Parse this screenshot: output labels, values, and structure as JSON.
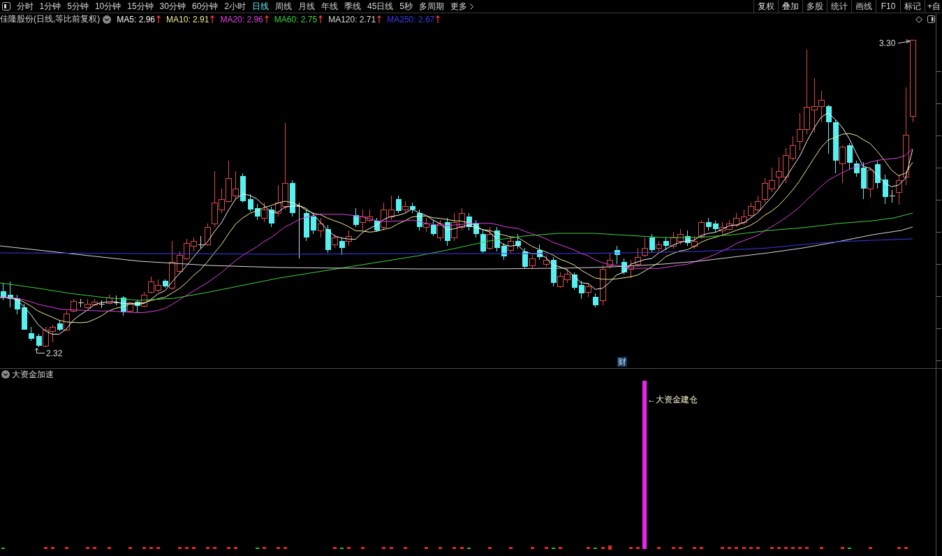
{
  "toolbar": {
    "periods": [
      {
        "label": "分时",
        "selected": false,
        "kind": "period"
      },
      {
        "label": "1分钟",
        "selected": false,
        "kind": "period"
      },
      {
        "label": "5分钟",
        "selected": false,
        "kind": "period"
      },
      {
        "label": "10分钟",
        "selected": false,
        "kind": "period"
      },
      {
        "label": "15分钟",
        "selected": false,
        "kind": "period"
      },
      {
        "label": "30分钟",
        "selected": false,
        "kind": "period"
      },
      {
        "label": "60分钟",
        "selected": false,
        "kind": "period"
      },
      {
        "label": "2小时",
        "selected": false,
        "kind": "period"
      },
      {
        "label": "日线",
        "selected": true,
        "kind": "period"
      },
      {
        "label": "周线",
        "selected": false,
        "kind": "period"
      },
      {
        "label": "月线",
        "selected": false,
        "kind": "period"
      },
      {
        "label": "年线",
        "selected": false,
        "kind": "period"
      },
      {
        "label": "季线",
        "selected": false,
        "kind": "period"
      },
      {
        "label": "45日线",
        "selected": false,
        "kind": "period"
      },
      {
        "label": "5秒",
        "selected": false,
        "kind": "period"
      },
      {
        "label": "多周期",
        "selected": false,
        "kind": "period"
      },
      {
        "label": "更多",
        "selected": false,
        "kind": "dropdown"
      }
    ],
    "tools": [
      "复权",
      "叠加",
      "多股",
      "统计",
      "画线",
      "F10",
      "标记",
      "+自"
    ]
  },
  "legend": {
    "title": "佳隆股份(日线,等比前复权)",
    "moving_averages": [
      {
        "label": "MA5: 2.96",
        "color": "#f4f4f4"
      },
      {
        "label": "MA10: 2.91",
        "color": "#f0ec96"
      },
      {
        "label": "MA20: 2.96",
        "color": "#e040e0"
      },
      {
        "label": "MA60: 2.75",
        "color": "#40d040"
      },
      {
        "label": "MA120: 2.71",
        "color": "#d8d8d8"
      },
      {
        "label": "MA250: 2.67",
        "color": "#3a3af0"
      }
    ]
  },
  "main_chart": {
    "high_label": "3.30",
    "low_label": "2.32",
    "badge": "财"
  },
  "indicator_panel": {
    "title": "大资金加速",
    "annotation": "←大资金建仓"
  }
}
